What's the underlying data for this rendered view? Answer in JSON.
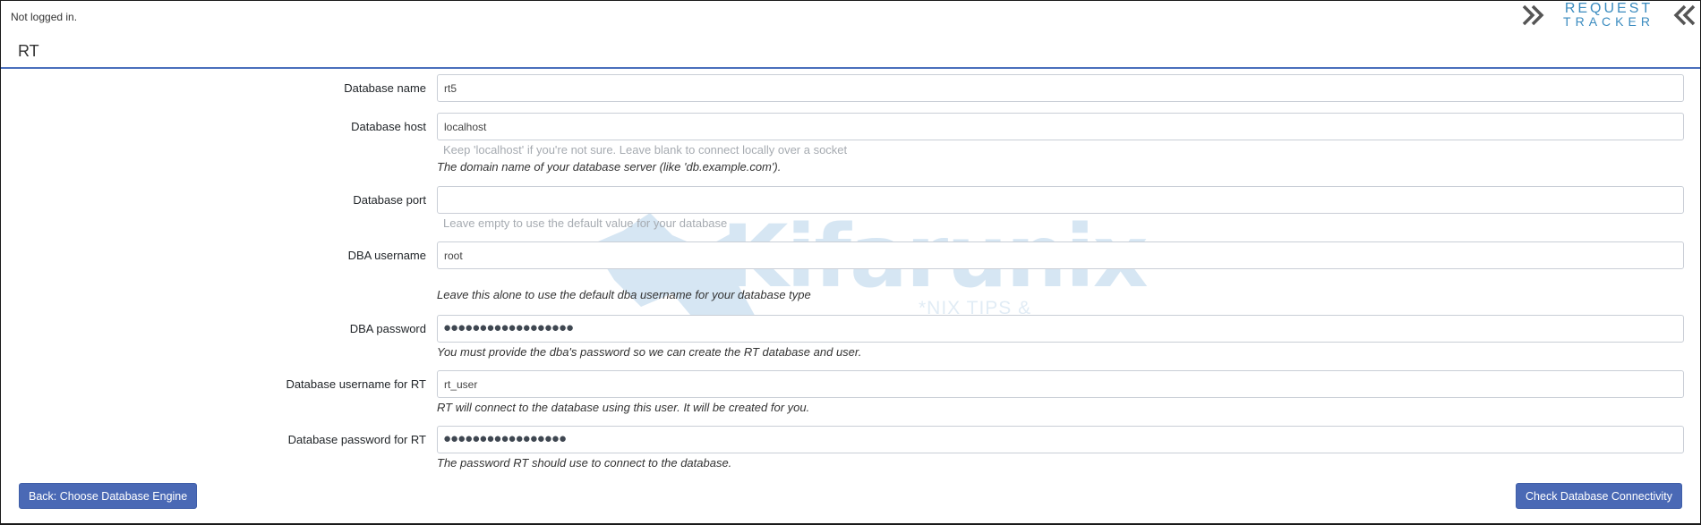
{
  "header": {
    "login_status": "Not logged in.",
    "logo": {
      "line1": "REQUEST",
      "line2": "TRACKER",
      "left_icon": "double-chevron-right-icon",
      "right_icon": "double-chevron-left-icon",
      "text_color": "#3a8bbf",
      "chevron_color": "#555555"
    }
  },
  "page": {
    "title": "RT",
    "accent_color": "#4a6fbc"
  },
  "watermark": {
    "text": "Kifarunix",
    "subtitle": "*NIX TIPS & TUTORIALS",
    "icon": "rhino-silhouette-icon"
  },
  "form": {
    "fields": [
      {
        "label": "Database name",
        "value": "rt5",
        "type": "text",
        "hint": "",
        "description": ""
      },
      {
        "label": "Database host",
        "value": "localhost",
        "type": "text",
        "hint": "Keep 'localhost' if you're not sure. Leave blank to connect locally over a socket",
        "description": "The domain name of your database server (like 'db.example.com')."
      },
      {
        "label": "Database port",
        "value": "",
        "type": "text",
        "hint": "Leave empty to use the default value for your database",
        "description": ""
      },
      {
        "label": "DBA username",
        "value": "root",
        "type": "text",
        "hint": "",
        "description": "Leave this alone to use the default dba username for your database type"
      },
      {
        "label": "DBA password",
        "value": "●●●●●●●●●●●●●●●●●●",
        "type": "password",
        "hint": "",
        "description": "You must provide the dba's password so we can create the RT database and user."
      },
      {
        "label": "Database username for RT",
        "value": "rt_user",
        "type": "text",
        "hint": "",
        "description": "RT will connect to the database using this user. It will be created for you."
      },
      {
        "label": "Database password for RT",
        "value": "●●●●●●●●●●●●●●●●●",
        "type": "password",
        "hint": "",
        "description": "The password RT should use to connect to the database."
      }
    ]
  },
  "buttons": {
    "back_label": "Back: Choose Database Engine",
    "check_label": "Check Database Connectivity",
    "color": "#4a69b5"
  }
}
